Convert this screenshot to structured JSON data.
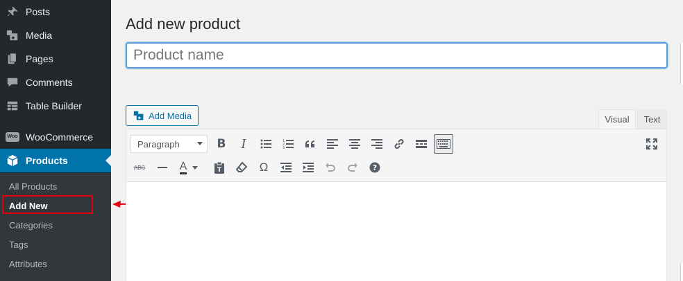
{
  "sidebar": {
    "items": [
      {
        "label": "Posts",
        "icon": "pushpin-icon"
      },
      {
        "label": "Media",
        "icon": "media-icon"
      },
      {
        "label": "Pages",
        "icon": "pages-icon"
      },
      {
        "label": "Comments",
        "icon": "comment-icon"
      },
      {
        "label": "Table Builder",
        "icon": "table-icon"
      },
      {
        "label": "WooCommerce",
        "icon": "woocommerce-icon",
        "icon_text": "Woo"
      },
      {
        "label": "Products",
        "icon": "product-box-icon",
        "active": true
      }
    ],
    "submenu": [
      {
        "label": "All Products"
      },
      {
        "label": "Add New",
        "current": true
      },
      {
        "label": "Categories"
      },
      {
        "label": "Tags"
      },
      {
        "label": "Attributes"
      }
    ]
  },
  "main": {
    "title": "Add new product",
    "title_input": {
      "value": "",
      "placeholder": "Product name"
    },
    "add_media_label": "Add Media",
    "tabs": [
      {
        "label": "Visual",
        "active": true
      },
      {
        "label": "Text"
      }
    ],
    "toolbar": {
      "format_select": "Paragraph",
      "row1": [
        "bold-icon",
        "italic-icon",
        "bulleted-list-icon",
        "numbered-list-icon",
        "blockquote-icon",
        "align-left-icon",
        "align-center-icon",
        "align-right-icon",
        "link-icon",
        "read-more-icon",
        "toolbar-toggle-icon"
      ],
      "row2": [
        "strikethrough-icon",
        "horizontal-line-icon",
        "text-color-icon",
        "paste-text-icon",
        "clear-formatting-icon",
        "special-character-icon",
        "outdent-icon",
        "indent-icon",
        "undo-icon",
        "redo-icon",
        "help-icon"
      ],
      "fullscreen": "fullscreen-icon",
      "text_color_glyph": "A",
      "omega_glyph": "Ω",
      "strike_glyph": "ABC"
    }
  },
  "colors": {
    "sidebar_bg": "#23282d",
    "submenu_bg": "#32373c",
    "active": "#0073aa",
    "annotation": "#e3000f"
  }
}
